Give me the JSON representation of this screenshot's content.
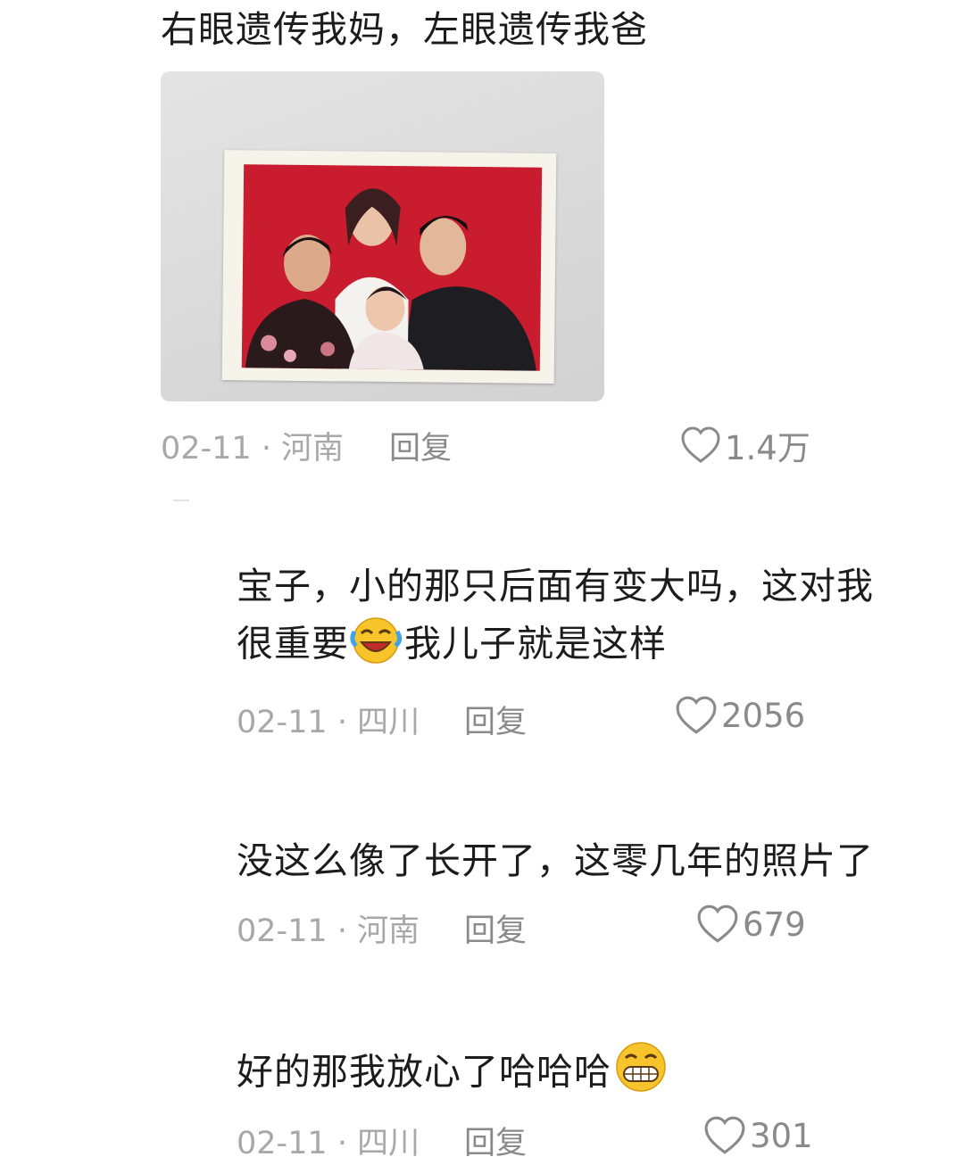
{
  "comments": [
    {
      "text": "右眼遗传我妈，左眼遗传我爸",
      "meta": "02-11 · 河南",
      "reply": "回复",
      "likes": "1.4万",
      "has_photo": true
    },
    {
      "text_line1": "宝子，小的那只后面有变大吗，这对我",
      "text_line2a": "很重要",
      "text_line2b": "我儿子就是这样",
      "emoji": "laughing-crying-emoji",
      "meta": "02-11 · 四川",
      "reply": "回复",
      "likes": "2056"
    },
    {
      "text": "没这么像了长开了，这零几年的照片了",
      "meta": "02-11 · 河南",
      "reply": "回复",
      "likes": "679"
    },
    {
      "text": "好的那我放心了哈哈哈",
      "emoji": "grinning-emoji",
      "meta": "02-11 · 四川",
      "reply": "回复",
      "likes": "301"
    }
  ],
  "colors": {
    "meta": "#a8a8a8",
    "reply": "#8a8a8a",
    "photo_background": "#c91c2e"
  }
}
